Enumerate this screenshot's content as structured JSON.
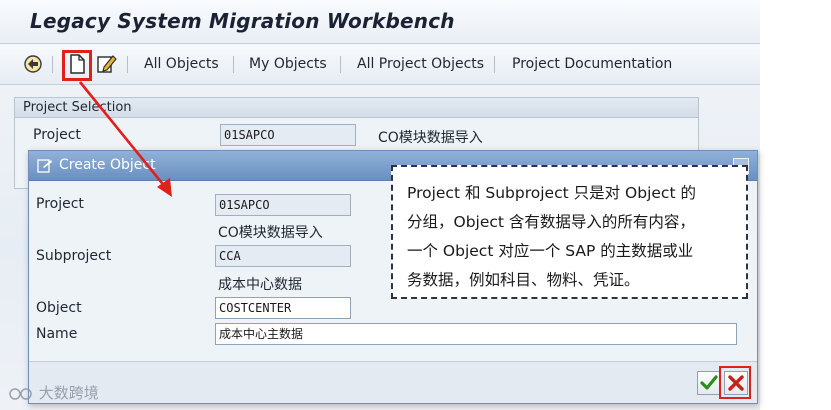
{
  "window": {
    "title": "Legacy System Migration Workbench"
  },
  "toolbar": {
    "icons": [
      "execute-icon",
      "create-document-icon",
      "edit-icon"
    ],
    "links": [
      "All Objects",
      "My Objects",
      "All Project Objects",
      "Project Documentation"
    ]
  },
  "project_selection": {
    "title": "Project Selection",
    "project_label": "Project",
    "project_value": "01SAPCO",
    "project_desc": "CO模块数据导入"
  },
  "dialog": {
    "title": "Create Object",
    "project_label": "Project",
    "project_value": "01SAPCO",
    "project_desc": "CO模块数据导入",
    "subproject_label": "Subproject",
    "subproject_value": "CCA",
    "subproject_desc": "成本中心数据",
    "object_label": "Object",
    "object_value": "COSTCENTER",
    "name_label": "Name",
    "name_value": "成本中心主数据",
    "buttons": [
      "confirm-check-icon",
      "cancel-x-icon"
    ]
  },
  "callout": {
    "lines": [
      "Project 和 Subproject 只是对 Object 的",
      "分组，Object 含有数据导入的所有内容，",
      "一个 Object 对应一个 SAP 的主数据或业",
      "务数据，例如科目、物料、凭证。"
    ]
  },
  "watermark": {
    "text": "大数跨境"
  },
  "colors": {
    "highlight": "#e0201a",
    "dialog_header": "#7a9dcb",
    "callout_border": "#2c3441"
  }
}
